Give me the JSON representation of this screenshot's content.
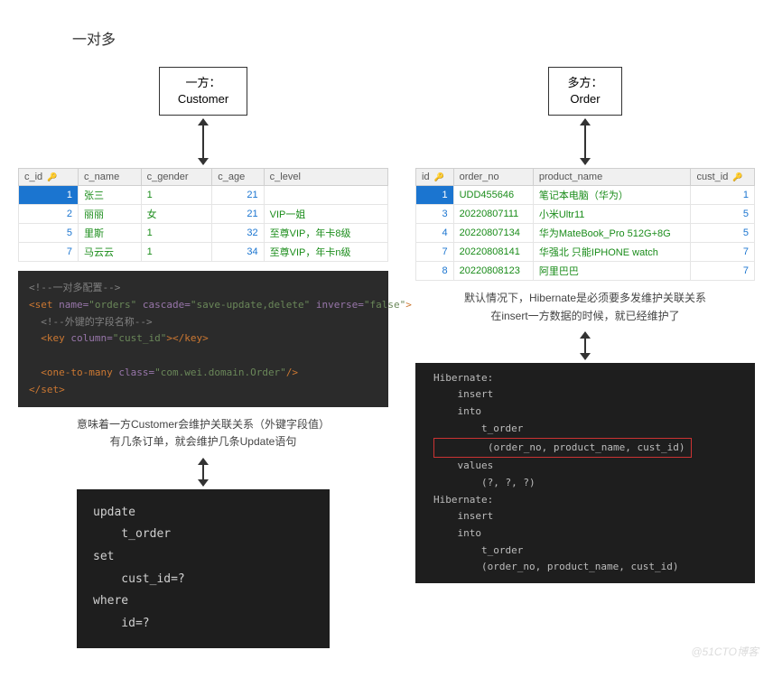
{
  "title": "一对多",
  "left": {
    "box_line1": "一方：",
    "box_line2": "Customer",
    "customer_table": {
      "headers": [
        "c_id",
        "c_name",
        "c_gender",
        "c_age",
        "c_level"
      ],
      "rows": [
        {
          "c_id": "1",
          "c_name": "张三",
          "c_gender": "1",
          "c_age": "21",
          "c_level": "",
          "selected": true
        },
        {
          "c_id": "2",
          "c_name": "丽丽",
          "c_gender": "女",
          "c_age": "21",
          "c_level": "VIP一姐"
        },
        {
          "c_id": "5",
          "c_name": "里斯",
          "c_gender": "1",
          "c_age": "32",
          "c_level": "至尊VIP，年卡8级"
        },
        {
          "c_id": "7",
          "c_name": "马云云",
          "c_gender": "1",
          "c_age": "34",
          "c_level": "至尊VIP，年卡n级"
        }
      ]
    },
    "xml": {
      "comment1": "<!--一对多配置-->",
      "set_open": "<set name=\"orders\" cascade=\"save-update,delete\" inverse=\"false\">",
      "comment2": "<!--外键的字段名称-->",
      "key": "<key column=\"cust_id\"></key>",
      "one_to_many": "<one-to-many class=\"com.wei.domain.Order\"/>",
      "set_close": "</set>"
    },
    "caption_line1": "意味着一方Customer会维护关联关系（外键字段值）",
    "caption_line2": "有几条订单，就会维护几条Update语句",
    "sql": "update\n    t_order\nset\n    cust_id=?\nwhere\n    id=?"
  },
  "right": {
    "box_line1": "多方：",
    "box_line2": "Order",
    "order_table": {
      "headers": [
        "id",
        "order_no",
        "product_name",
        "cust_id"
      ],
      "rows": [
        {
          "id": "1",
          "order_no": "UDD455646",
          "product_name": "笔记本电脑（华为）",
          "cust_id": "1",
          "selected": true
        },
        {
          "id": "3",
          "order_no": "20220807111",
          "product_name": "小米Ultr11",
          "cust_id": "5"
        },
        {
          "id": "4",
          "order_no": "20220807134",
          "product_name": "华为MateBook_Pro 512G+8G",
          "cust_id": "5"
        },
        {
          "id": "7",
          "order_no": "20220808141",
          "product_name": "华强北 只能IPHONE watch",
          "cust_id": "7"
        },
        {
          "id": "8",
          "order_no": "20220808123",
          "product_name": "阿里巴巴",
          "cust_id": "7"
        }
      ]
    },
    "caption_line1": "默认情况下，Hibernate是必须要多发维护关联关系",
    "caption_line2": "在insert一方数据的时候，就已经维护了",
    "hib_log": {
      "l1": "Hibernate:",
      "l2": "    insert",
      "l3": "    into",
      "l4": "        t_order",
      "l5_hl": "        (order_no, product_name, cust_id)",
      "l6": "    values",
      "l7": "        (?, ?, ?)",
      "l8": "Hibernate:",
      "l9": "    insert",
      "l10": "    into",
      "l11": "        t_order",
      "l12": "        (order_no, product_name, cust_id)"
    }
  },
  "watermark": "@51CTO博客"
}
